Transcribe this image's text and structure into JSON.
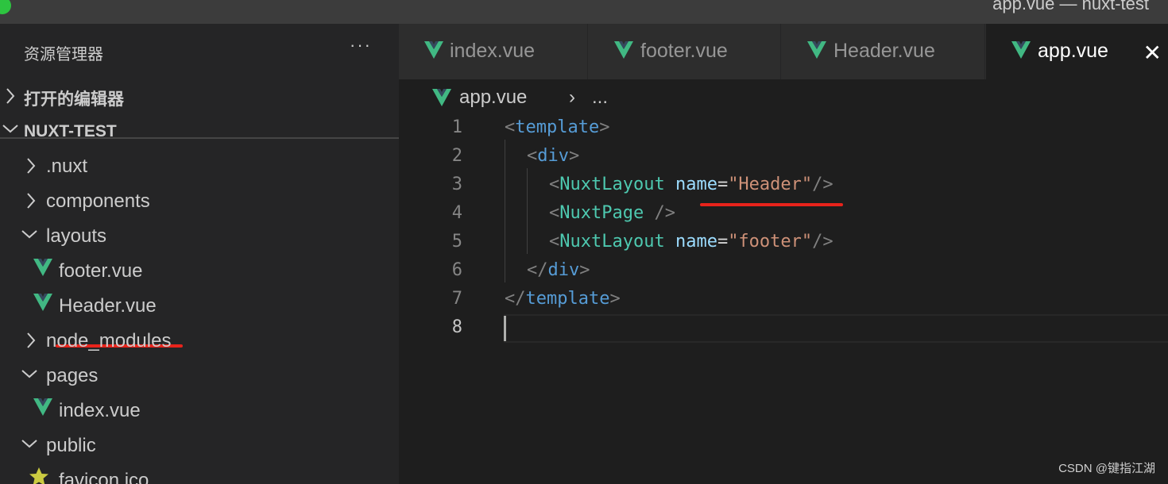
{
  "window": {
    "title": "app.vue — nuxt-test"
  },
  "explorer": {
    "title": "资源管理器",
    "more_label": "···",
    "open_editors_label": "打开的编辑器",
    "project_label": "NUXT-TEST",
    "tree": [
      {
        "label": ".nuxt",
        "type": "folder",
        "expanded": false
      },
      {
        "label": "components",
        "type": "folder",
        "expanded": false
      },
      {
        "label": "layouts",
        "type": "folder",
        "expanded": true
      },
      {
        "label": "footer.vue",
        "type": "vue-file"
      },
      {
        "label": "Header.vue",
        "type": "vue-file"
      },
      {
        "label": "node_modules",
        "type": "folder",
        "expanded": false
      },
      {
        "label": "pages",
        "type": "folder",
        "expanded": true
      },
      {
        "label": "index.vue",
        "type": "vue-file"
      },
      {
        "label": "public",
        "type": "folder",
        "expanded": true
      },
      {
        "label": "favicon.ico",
        "type": "star-file"
      }
    ]
  },
  "tabs": [
    {
      "label": "index.vue",
      "active": false
    },
    {
      "label": "footer.vue",
      "active": false
    },
    {
      "label": "Header.vue",
      "active": false
    },
    {
      "label": "app.vue",
      "active": true
    }
  ],
  "tab_close_label": "✕",
  "breadcrumb": {
    "file": "app.vue",
    "separator": "›",
    "more": "..."
  },
  "editor": {
    "line_numbers": [
      "1",
      "2",
      "3",
      "4",
      "5",
      "6",
      "7",
      "8"
    ],
    "current_line": "8",
    "lines": {
      "l1": {
        "open": "<",
        "tag": "template",
        "close": ">"
      },
      "l2": {
        "open": "<",
        "tag": "div",
        "close": ">"
      },
      "l3": {
        "open": "<",
        "comp": "NuxtLayout",
        "attr": "name",
        "eq": "=",
        "val": "\"Header\"",
        "close": "/>"
      },
      "l4": {
        "open": "<",
        "comp": "NuxtPage",
        "close": " />"
      },
      "l5": {
        "open": "<",
        "comp": "NuxtLayout",
        "attr": "name",
        "eq": "=",
        "val": "\"footer\"",
        "close": "/>"
      },
      "l6": {
        "open": "</",
        "tag": "div",
        "close": ">"
      },
      "l7": {
        "open": "</",
        "tag": "template",
        "close": ">"
      }
    }
  },
  "watermark": "CSDN @键指江湖",
  "colors": {
    "vue_green": "#41b883",
    "vue_dark": "#35495e",
    "annotation_red": "#e8231b",
    "tag_blue": "#569cd6",
    "component_teal": "#4ec9b0",
    "attribute_lightblue": "#9cdcfe",
    "string_orange": "#ce9178"
  }
}
